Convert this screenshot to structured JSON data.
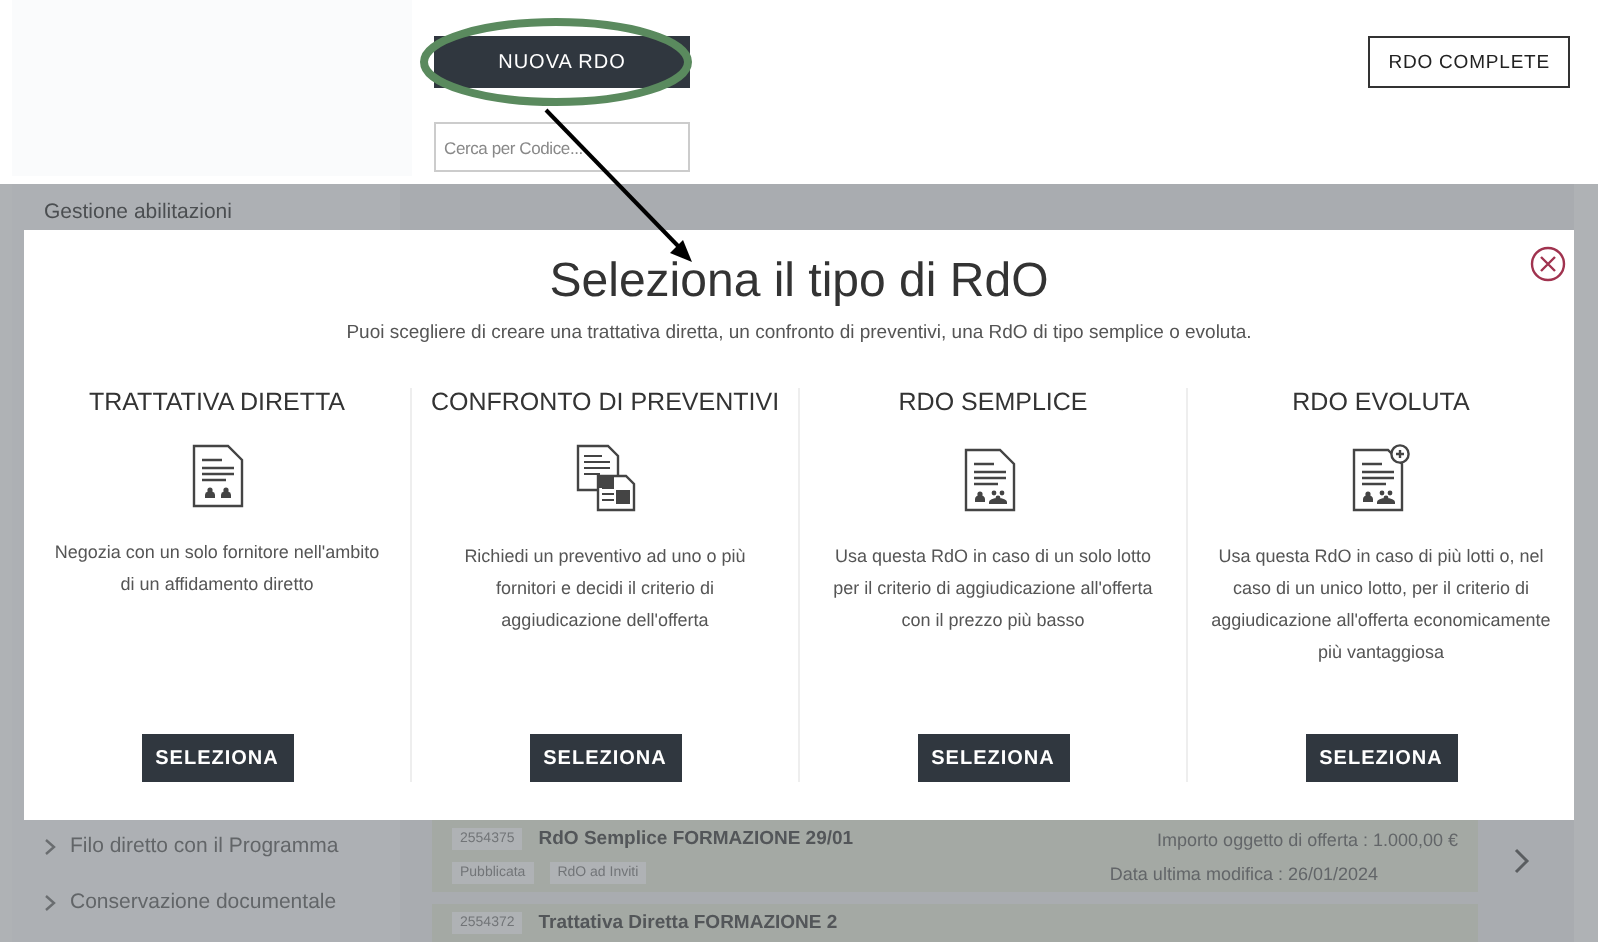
{
  "header": {
    "new_button": "NUOVA RDO",
    "search": {
      "placeholder": "Cerca per Codice..."
    },
    "complete_button": "RDO COMPLETE"
  },
  "sidebar_top": "Gestione abilitazioni",
  "sidebar_bottom": [
    "Filo diretto con il Programma",
    "Conservazione documentale"
  ],
  "rdo_list": [
    {
      "code": "2554375",
      "title": "RdO Semplice FORMAZIONE 29/01",
      "amount": "Importo oggetto di offerta : 1.000,00 €",
      "tags": [
        "Pubblicata",
        "RdO ad Inviti"
      ],
      "modified": "Data ultima modifica : 26/01/2024"
    },
    {
      "code": "2554372",
      "title": "Trattativa Diretta FORMAZIONE 2"
    }
  ],
  "modal": {
    "title": "Seleziona il tipo di RdO",
    "subtitle": "Puoi scegliere di creare una trattativa diretta, un confronto di preventivi, una RdO di tipo semplice o evoluta.",
    "options": [
      {
        "heading": "TRATTATIVA DIRETTA",
        "kind": "single",
        "description": "Negozia con un solo fornitore nell'ambito di un affidamento diretto",
        "button": "SELEZIONA"
      },
      {
        "heading": "CONFRONTO DI PREVENTIVI",
        "kind": "compare",
        "description": "Richiedi un preventivo ad uno o più fornitori e decidi il criterio di aggiudicazione dell'offerta",
        "button": "SELEZIONA"
      },
      {
        "heading": "RDO SEMPLICE",
        "kind": "group",
        "description": "Usa questa RdO in caso di un solo lotto per il criterio di aggiudicazione all'offerta con il prezzo più basso",
        "button": "SELEZIONA"
      },
      {
        "heading": "RDO EVOLUTA",
        "kind": "group-plus",
        "description": "Usa questa RdO in caso di più lotti o, nel caso di un unico lotto, per il criterio di aggiudicazione all'offerta economicamente più vantaggiosa",
        "button": "SELEZIONA"
      }
    ]
  }
}
